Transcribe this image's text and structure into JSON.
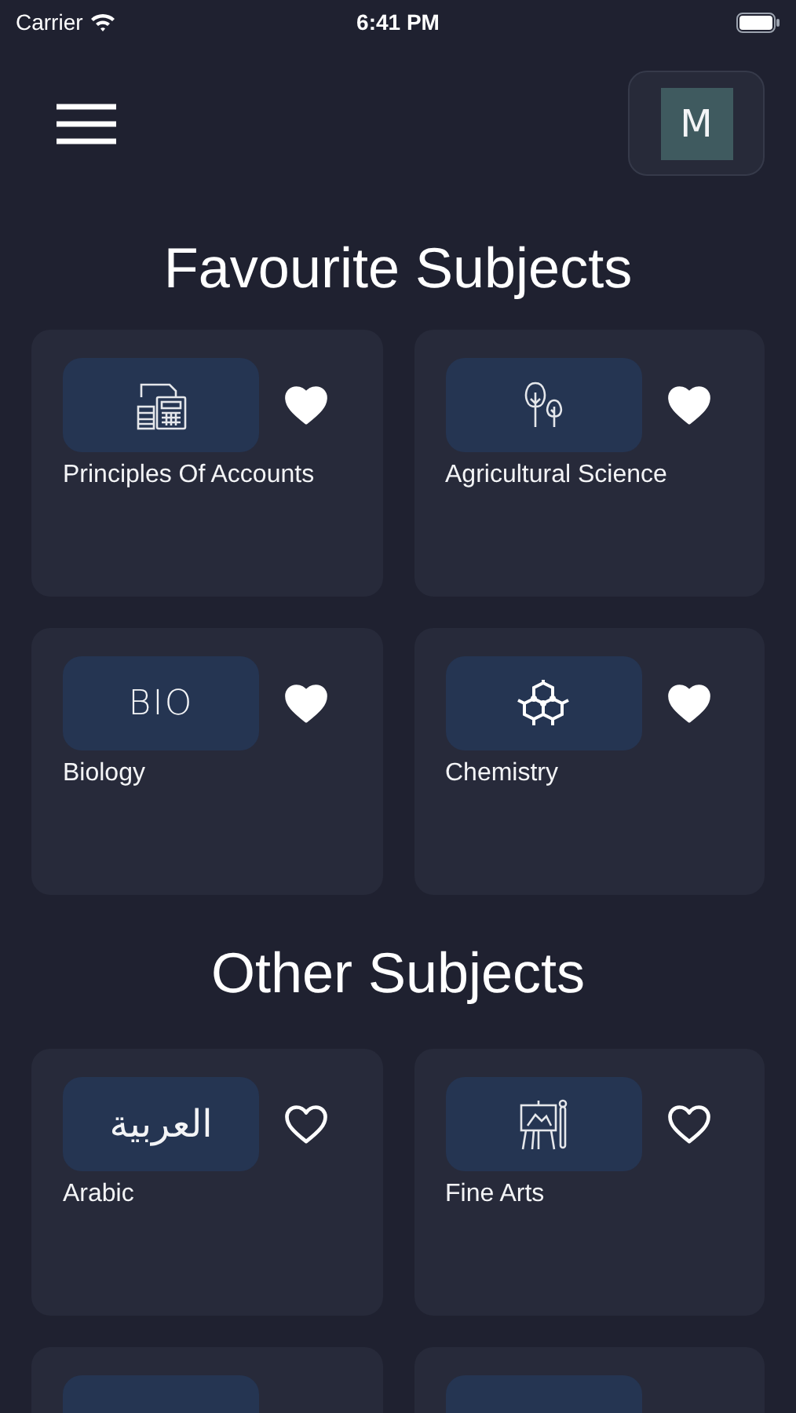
{
  "status_bar": {
    "carrier": "Carrier",
    "time": "6:41 PM"
  },
  "header": {
    "avatar_initial": "M"
  },
  "sections": [
    {
      "title": "Favourite Subjects",
      "subjects": [
        {
          "kind": "subject",
          "name": "Principles Of Accounts",
          "favourite": true
        },
        {
          "kind": "subject",
          "name": "Agricultural Science",
          "favourite": true
        },
        {
          "kind": "subject",
          "icon_text": "BIO",
          "name": "Biology",
          "favourite": true
        },
        {
          "kind": "subject",
          "name": "Chemistry",
          "favourite": true
        }
      ]
    },
    {
      "title": "Other Subjects",
      "subjects": [
        {
          "kind": "subject",
          "icon_text": "العربية",
          "name": "Arabic",
          "favourite": false
        },
        {
          "kind": "subject",
          "name": "Fine Arts",
          "favourite": false
        },
        {
          "kind": "cut"
        },
        {
          "kind": "cut"
        }
      ]
    }
  ]
}
